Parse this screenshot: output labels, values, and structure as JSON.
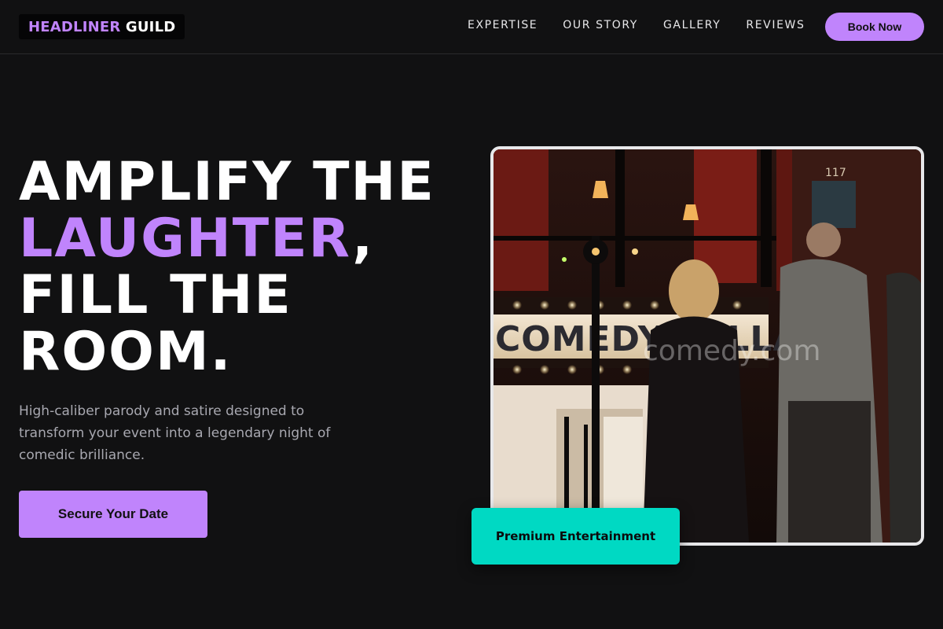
{
  "header": {
    "logo_accent": "HEADLINER",
    "logo_plain": " GUILD",
    "nav": [
      "EXPERTISE",
      "OUR STORY",
      "GALLERY",
      "REVIEWS"
    ],
    "book_label": "Book Now"
  },
  "hero": {
    "headline_line1": "AMPLIFY THE",
    "headline_highlight": "LAUGHTER",
    "headline_comma": ",",
    "headline_line3": "FILL THE",
    "headline_line4": "ROOM.",
    "subtext": "High-caliber parody and satire designed to transform your event into a legendary night of comedic brilliance.",
    "cta_label": "Secure Your Date",
    "badge_label": "Premium Entertainment",
    "photo_sign": "COMEDY CELLAR",
    "photo_watermark": "comedy.com",
    "photo_door_number": "117"
  },
  "colors": {
    "accent": "#c084fc",
    "badge": "#00d9c3",
    "background": "#111112"
  }
}
